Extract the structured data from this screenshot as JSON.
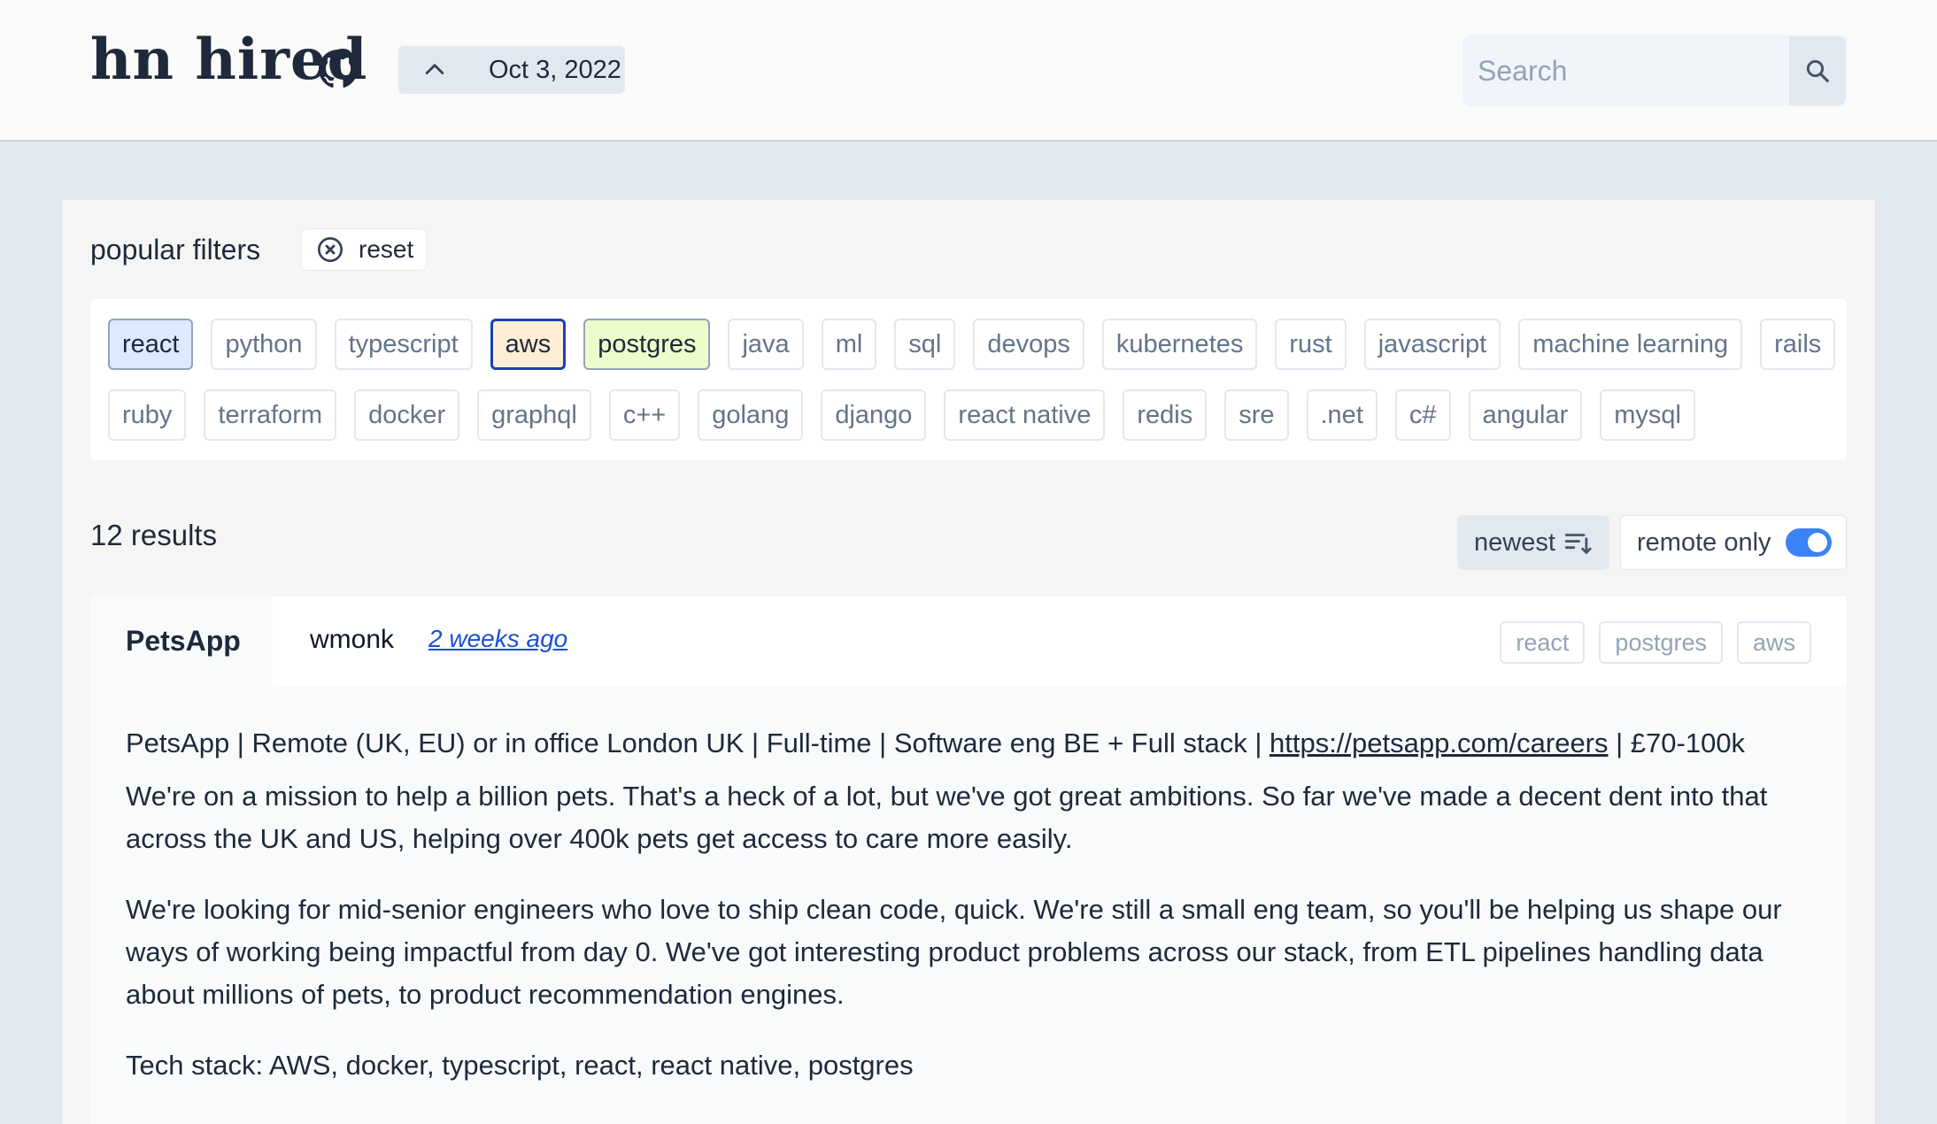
{
  "header": {
    "logo": "hn hired",
    "date": "Oct 3, 2022",
    "search_placeholder": "Search"
  },
  "filters": {
    "title": "popular filters",
    "reset_label": "reset",
    "row1": [
      "react",
      "python",
      "typescript",
      "aws",
      "postgres",
      "java",
      "ml",
      "sql",
      "devops",
      "kubernetes",
      "rust",
      "javascript",
      "machine learning",
      "rails"
    ],
    "row2": [
      "ruby",
      "terraform",
      "docker",
      "graphql",
      "c++",
      "golang",
      "django",
      "react native",
      "redis",
      "sre",
      ".net",
      "c#",
      "angular",
      "mysql"
    ],
    "selected": [
      "react",
      "aws",
      "postgres"
    ]
  },
  "results": {
    "count_label": "12 results",
    "sort_label": "newest",
    "remote_label": "remote only",
    "remote_only": true
  },
  "job": {
    "company": "PetsApp",
    "author": "wmonk",
    "posted": "2 weeks ago",
    "tags": [
      "react",
      "postgres",
      "aws"
    ],
    "headline_prefix": "PetsApp | Remote (UK, EU) or in office London UK | Full-time | Software eng BE + Full stack | ",
    "headline_link": "https://petsapp.com/careers",
    "headline_suffix": " | £70-100k",
    "para1": "We're on a mission to help a billion pets. That's a heck of a lot, but we've got great ambitions. So far we've made a decent dent into that across the UK and US, helping over 400k pets get access to care more easily.",
    "para2": "We're looking for mid-senior engineers who love to ship clean code, quick. We're still a small eng team, so you'll be helping us shape our ways of working being impactful from day 0. We've got interesting product problems across our stack, from ETL pipelines handling data about millions of pets, to product recommendation engines.",
    "para3": "Tech stack: AWS, docker, typescript, react, react native, postgres"
  },
  "colors": {
    "accent": "#3b82f6",
    "link": "#1d4ed8",
    "selected_react": "#dbeafe",
    "selected_aws": "#ffedd5",
    "selected_postgres": "#ecfccb"
  },
  "icons": [
    "github-icon",
    "chevron-up-icon",
    "search-icon",
    "close-circle-icon",
    "sort-icon"
  ]
}
